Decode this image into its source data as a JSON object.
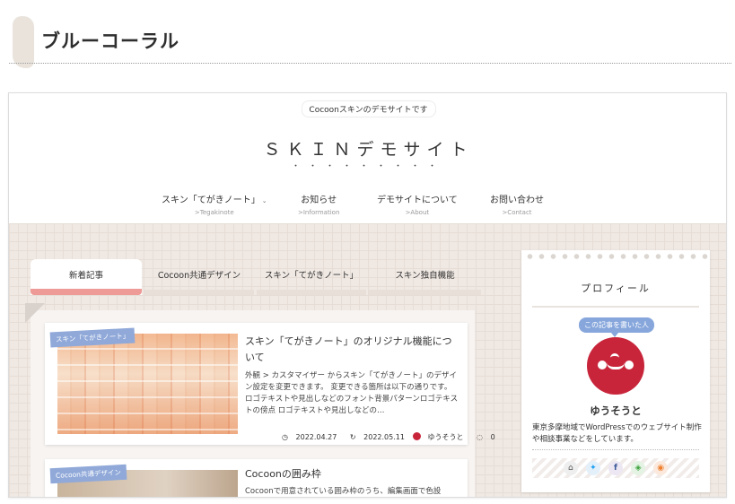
{
  "page": {
    "heading": "ブルーコーラル"
  },
  "site": {
    "tagline": "Cocoonスキンのデモサイトです",
    "title": "ＳＫＩＮデモサイト",
    "title_dots": "・・・・・・・・・"
  },
  "nav": [
    {
      "label": "スキン「てがきノート」",
      "sub": ">Tegakinote",
      "caret": "⌄"
    },
    {
      "label": "お知らせ",
      "sub": ">Information"
    },
    {
      "label": "デモサイトについて",
      "sub": ">About"
    },
    {
      "label": "お問い合わせ",
      "sub": ">Contact"
    }
  ],
  "tabs": [
    {
      "label": "新着記事",
      "active": true
    },
    {
      "label": "Cocoon共通デザイン"
    },
    {
      "label": "スキン「てがきノート」"
    },
    {
      "label": "スキン独自機能"
    }
  ],
  "articles": [
    {
      "category": "スキン「てがきノート」",
      "title": "スキン「てがきノート」のオリジナル機能について",
      "snippet": "外観 > カスタマイザー からスキン「てがきノート」のデザイン設定を変更できます。 変更できる箇所は以下の通りです。 ロゴテキストや見出しなどのフォント背景パターンロゴテキストの傍点 ロゴテキストや見出しなどの…",
      "date_posted": "2022.04.27",
      "date_updated": "2022.05.11",
      "author": "ゆうそうと",
      "comments": "0"
    },
    {
      "category": "Cocoon共通デザイン",
      "title": "Cocoonの囲み枠",
      "snippet": "Cocoonで用意されている囲み枠のうち、編集画面で色設"
    }
  ],
  "sidebar": {
    "title": "プロフィール",
    "badge": "この記事を書いた人",
    "author_name": "ゆうそうと",
    "author_desc": "東京多摩地域でWordPressでのウェブサイト制作や相談事業などをしています。",
    "social_icons": [
      "home-icon",
      "twitter-icon",
      "facebook-icon",
      "feedly-icon",
      "rss-icon"
    ]
  },
  "icons": {
    "clock": "◷",
    "update": "↻",
    "comment": "◌",
    "home": "⌂",
    "twitter": "✦",
    "facebook": "f",
    "feedly": "◈",
    "rss": "◉"
  },
  "colors": {
    "accent_coral": "#ee9a96",
    "category_blue": "#90a9d9",
    "avatar_red": "#c8253b"
  }
}
